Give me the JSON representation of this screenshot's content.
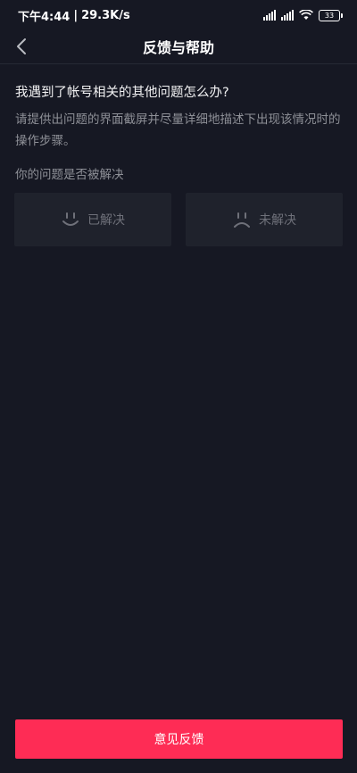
{
  "status_bar": {
    "time": "下午4:44",
    "separator": "|",
    "net_speed": "29.3K/s",
    "battery_level": "33",
    "icons": [
      "signal-icon",
      "signal-icon-4g",
      "wifi-icon",
      "battery-icon"
    ]
  },
  "nav": {
    "title": "反馈与帮助",
    "back_icon": "chevron-left-icon"
  },
  "content": {
    "question": "我遇到了帐号相关的其他问题怎么办?",
    "description": "请提供出问题的界面截屏并尽量详细地描述下出现该情况时的操作步骤。",
    "resolved_prompt": "你的问题是否被解决",
    "options": [
      {
        "label": "已解决",
        "icon": "smile-icon"
      },
      {
        "label": "未解决",
        "icon": "frown-icon"
      }
    ]
  },
  "footer": {
    "submit_label": "意见反馈"
  },
  "colors": {
    "background": "#161823",
    "accent": "#fe2c55",
    "muted_text": "#8e9097",
    "option_bg": "#1f222c"
  }
}
